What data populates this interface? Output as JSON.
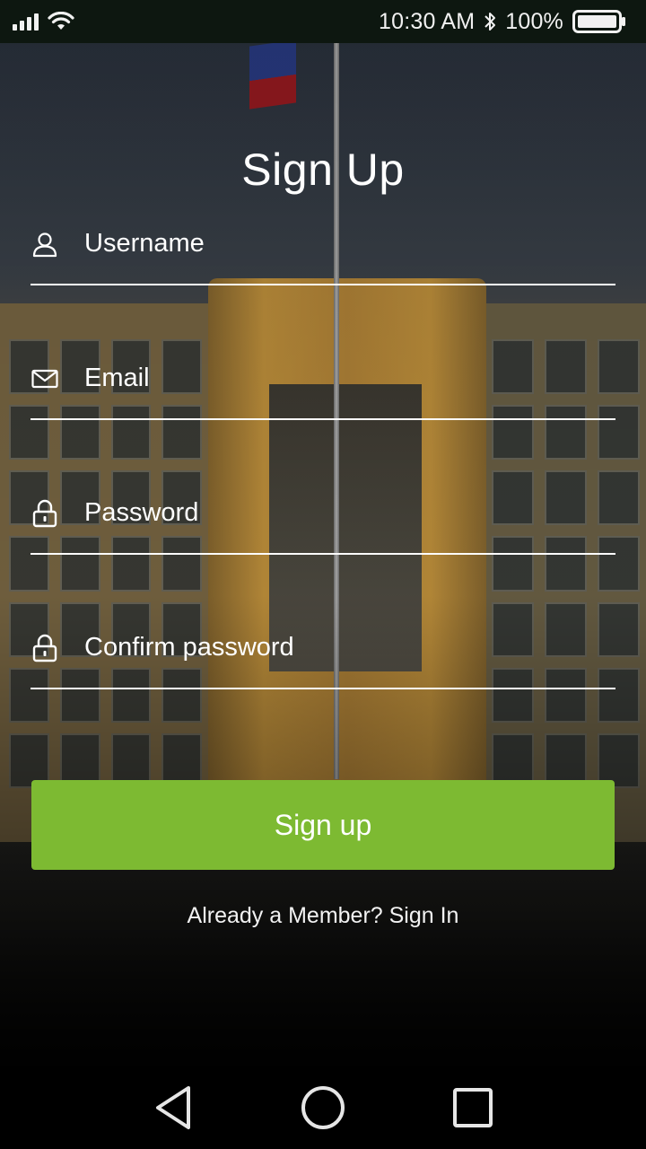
{
  "status_bar": {
    "time": "10:30 AM",
    "battery_percent": "100%",
    "icons": [
      "signal-icon",
      "wifi-icon",
      "bluetooth-icon",
      "battery-icon"
    ]
  },
  "form": {
    "title": "Sign Up",
    "fields": [
      {
        "icon": "user-icon",
        "placeholder": "Username",
        "type": "text"
      },
      {
        "icon": "mail-icon",
        "placeholder": "Email",
        "type": "email"
      },
      {
        "icon": "lock-icon",
        "placeholder": "Password",
        "type": "password"
      },
      {
        "icon": "lock-icon",
        "placeholder": "Confirm password",
        "type": "password"
      }
    ],
    "submit_label": "Sign up",
    "signin_link": "Already a Member? Sign In"
  },
  "nav_bar": {
    "icons": [
      "back-icon",
      "home-icon",
      "recents-icon"
    ]
  },
  "colors": {
    "accent": "#7dba32",
    "text": "#ffffff",
    "status_bar_bg": "#0d1710"
  }
}
